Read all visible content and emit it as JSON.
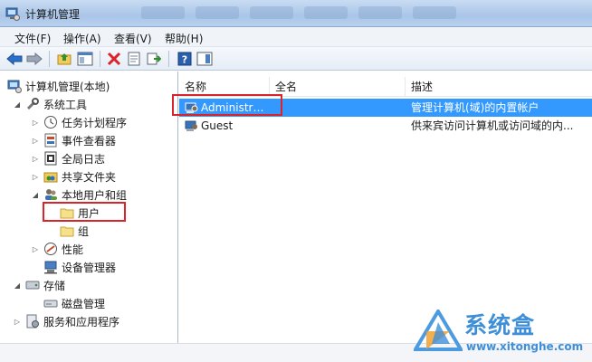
{
  "window": {
    "title": "计算机管理"
  },
  "menu": [
    {
      "label": "文件(F)"
    },
    {
      "label": "操作(A)"
    },
    {
      "label": "查看(V)"
    },
    {
      "label": "帮助(H)"
    }
  ],
  "toolbar": {
    "icons": [
      "back-arrow-icon",
      "forward-arrow-icon",
      "up-folder-icon",
      "show-hide-tree-icon",
      "delete-icon",
      "properties-icon",
      "export-icon",
      "help-icon",
      "action-pane-icon"
    ]
  },
  "tree": {
    "items": [
      {
        "label": "计算机管理(本地)",
        "icon": "computer-management-icon",
        "level": 0,
        "toggle": ""
      },
      {
        "label": "系统工具",
        "icon": "tools-icon",
        "level": 1,
        "toggle": "expanded"
      },
      {
        "label": "任务计划程序",
        "icon": "clock-icon",
        "level": 2,
        "toggle": "collapsed"
      },
      {
        "label": "事件查看器",
        "icon": "event-viewer-icon",
        "level": 2,
        "toggle": "collapsed"
      },
      {
        "label": "全局日志",
        "icon": "log-icon",
        "level": 2,
        "toggle": "collapsed"
      },
      {
        "label": "共享文件夹",
        "icon": "shared-folder-icon",
        "level": 2,
        "toggle": "collapsed"
      },
      {
        "label": "本地用户和组",
        "icon": "users-group-icon",
        "level": 2,
        "toggle": "expanded"
      },
      {
        "label": "用户",
        "icon": "folder-icon",
        "level": 3,
        "toggle": ""
      },
      {
        "label": "组",
        "icon": "folder-icon",
        "level": 3,
        "toggle": ""
      },
      {
        "label": "性能",
        "icon": "performance-icon",
        "level": 2,
        "toggle": "collapsed"
      },
      {
        "label": "设备管理器",
        "icon": "device-manager-icon",
        "level": 2,
        "toggle": ""
      },
      {
        "label": "存储",
        "icon": "storage-icon",
        "level": 1,
        "toggle": "expanded"
      },
      {
        "label": "磁盘管理",
        "icon": "disk-icon",
        "level": 2,
        "toggle": ""
      },
      {
        "label": "服务和应用程序",
        "icon": "services-icon",
        "level": 1,
        "toggle": "collapsed"
      }
    ]
  },
  "list": {
    "columns": [
      {
        "label": "名称"
      },
      {
        "label": "全名"
      },
      {
        "label": "描述"
      }
    ],
    "rows": [
      {
        "name": "Administrat...",
        "fullname": "",
        "description": "管理计算机(域)的内置帐户",
        "selected": true
      },
      {
        "name": "Guest",
        "fullname": "",
        "description": "供来宾访问计算机或访问域的内...",
        "selected": false
      }
    ]
  },
  "watermark": {
    "text": "系统盒",
    "url": "www.xitonghe.com"
  },
  "colors": {
    "selection": "#3399ff",
    "highlight_box": "#d9242b",
    "watermark": "#3f8fd8"
  }
}
